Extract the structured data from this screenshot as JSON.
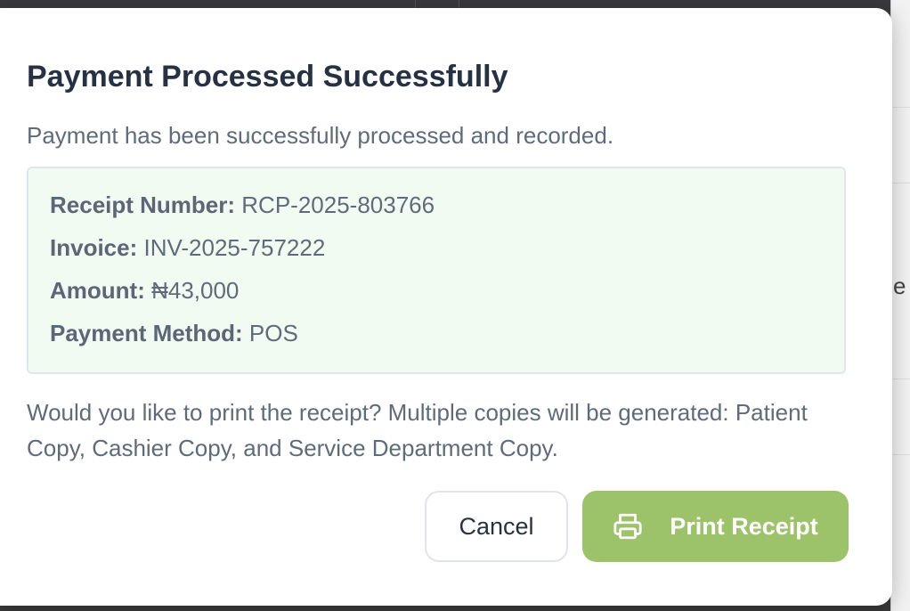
{
  "dialog": {
    "title": "Payment Processed Successfully",
    "subtitle": "Payment has been successfully processed and recorded.",
    "details": {
      "receipt_label": "Receipt Number:",
      "receipt_value": "RCP-2025-803766",
      "invoice_label": "Invoice:",
      "invoice_value": "INV-2025-757222",
      "amount_label": "Amount:",
      "amount_value": "₦43,000",
      "method_label": "Payment Method:",
      "method_value": "POS"
    },
    "prompt": "Would you like to print the receipt? Multiple copies will be generated: Patient Copy, Cashier Copy, and Service Department Copy.",
    "cancel_label": "Cancel",
    "print_label": "Print Receipt",
    "print_icon": "printer-icon"
  },
  "background": {
    "partial_text": "e"
  },
  "colors": {
    "accent": "#9dc36a",
    "details_bg": "#f2fbf2",
    "title": "#263244",
    "body_text": "#5f6b7b"
  }
}
